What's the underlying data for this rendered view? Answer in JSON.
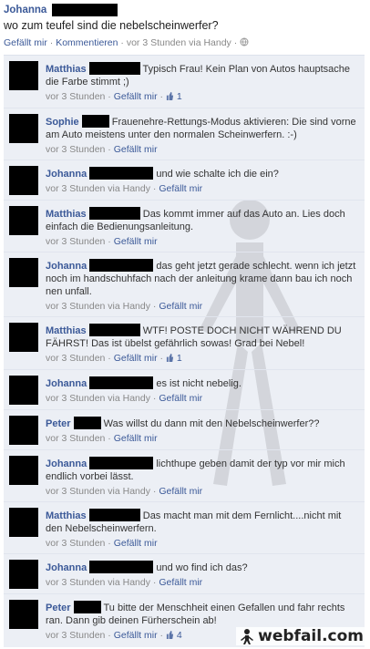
{
  "post": {
    "author": "Johanna",
    "status": "wo zum teufel sind die nebelscheinwerfer?",
    "like_label": "Gefällt mir",
    "comment_label": "Kommentieren",
    "timestamp": "vor 3 Stunden via Handy",
    "sep": "·"
  },
  "comments": [
    {
      "author": "Matthias",
      "text": "Typisch Frau! Kein Plan von Autos hauptsache die Farbe stimmt ;)",
      "time": "vor 3 Stunden",
      "like": "Gefällt mir",
      "likes": "1"
    },
    {
      "author": "Sophie",
      "text": "Frauenehre-Rettungs-Modus aktivieren: Die sind vorne am Auto meistens unter den normalen Scheinwerfern. :-)",
      "time": "vor 3 Stunden",
      "like": "Gefällt mir",
      "likes": ""
    },
    {
      "author": "Johanna",
      "text": "und wie schalte ich die ein?",
      "time": "vor 3 Stunden via Handy",
      "like": "Gefällt mir",
      "likes": ""
    },
    {
      "author": "Matthias",
      "text": "Das kommt immer auf das Auto an. Lies doch einfach die Bedienungsanleitung.",
      "time": "vor 3 Stunden",
      "like": "Gefällt mir",
      "likes": ""
    },
    {
      "author": "Johanna",
      "text": "das geht jetzt gerade schlecht. wenn ich jetzt noch im handschuhfach nach der anleitung krame dann bau ich noch nen unfall.",
      "time": "vor 3 Stunden via Handy",
      "like": "Gefällt mir",
      "likes": ""
    },
    {
      "author": "Matthias",
      "text": "WTF! POSTE DOCH NICHT WÄHREND DU FÄHRST! Das ist übelst gefährlich sowas! Grad bei Nebel!",
      "time": "vor 3 Stunden",
      "like": "Gefällt mir",
      "likes": "1"
    },
    {
      "author": "Johanna",
      "text": "es ist nicht nebelig.",
      "time": "vor 3 Stunden via Handy",
      "like": "Gefällt mir",
      "likes": ""
    },
    {
      "author": "Peter",
      "text": "Was willst du dann mit den Nebelscheinwerfer??",
      "time": "vor 3 Stunden",
      "like": "Gefällt mir",
      "likes": ""
    },
    {
      "author": "Johanna",
      "text": "lichthupe geben damit der typ vor mir mich endlich vorbei lässt.",
      "time": "vor 3 Stunden via Handy",
      "like": "Gefällt mir",
      "likes": ""
    },
    {
      "author": "Matthias",
      "text": "Das macht man mit dem Fernlicht....nicht mit den Nebelscheinwerfern.",
      "time": "vor 3 Stunden",
      "like": "Gefällt mir",
      "likes": ""
    },
    {
      "author": "Johanna",
      "text": "und wo find ich das?",
      "time": "vor 3 Stunden via Handy",
      "like": "Gefällt mir",
      "likes": ""
    },
    {
      "author": "Peter",
      "text": "Tu bitte der Menschheit einen Gefallen und fahr rechts ran. Dann gib deinen Fürherschein ab!",
      "time": "vor 3 Stunden",
      "like": "Gefällt mir",
      "likes": "4"
    }
  ],
  "watermark": {
    "text": "webfail.com"
  },
  "colors": {
    "link": "#3b5998",
    "comment_bg": "#eceff5",
    "redaction": "#000000"
  }
}
